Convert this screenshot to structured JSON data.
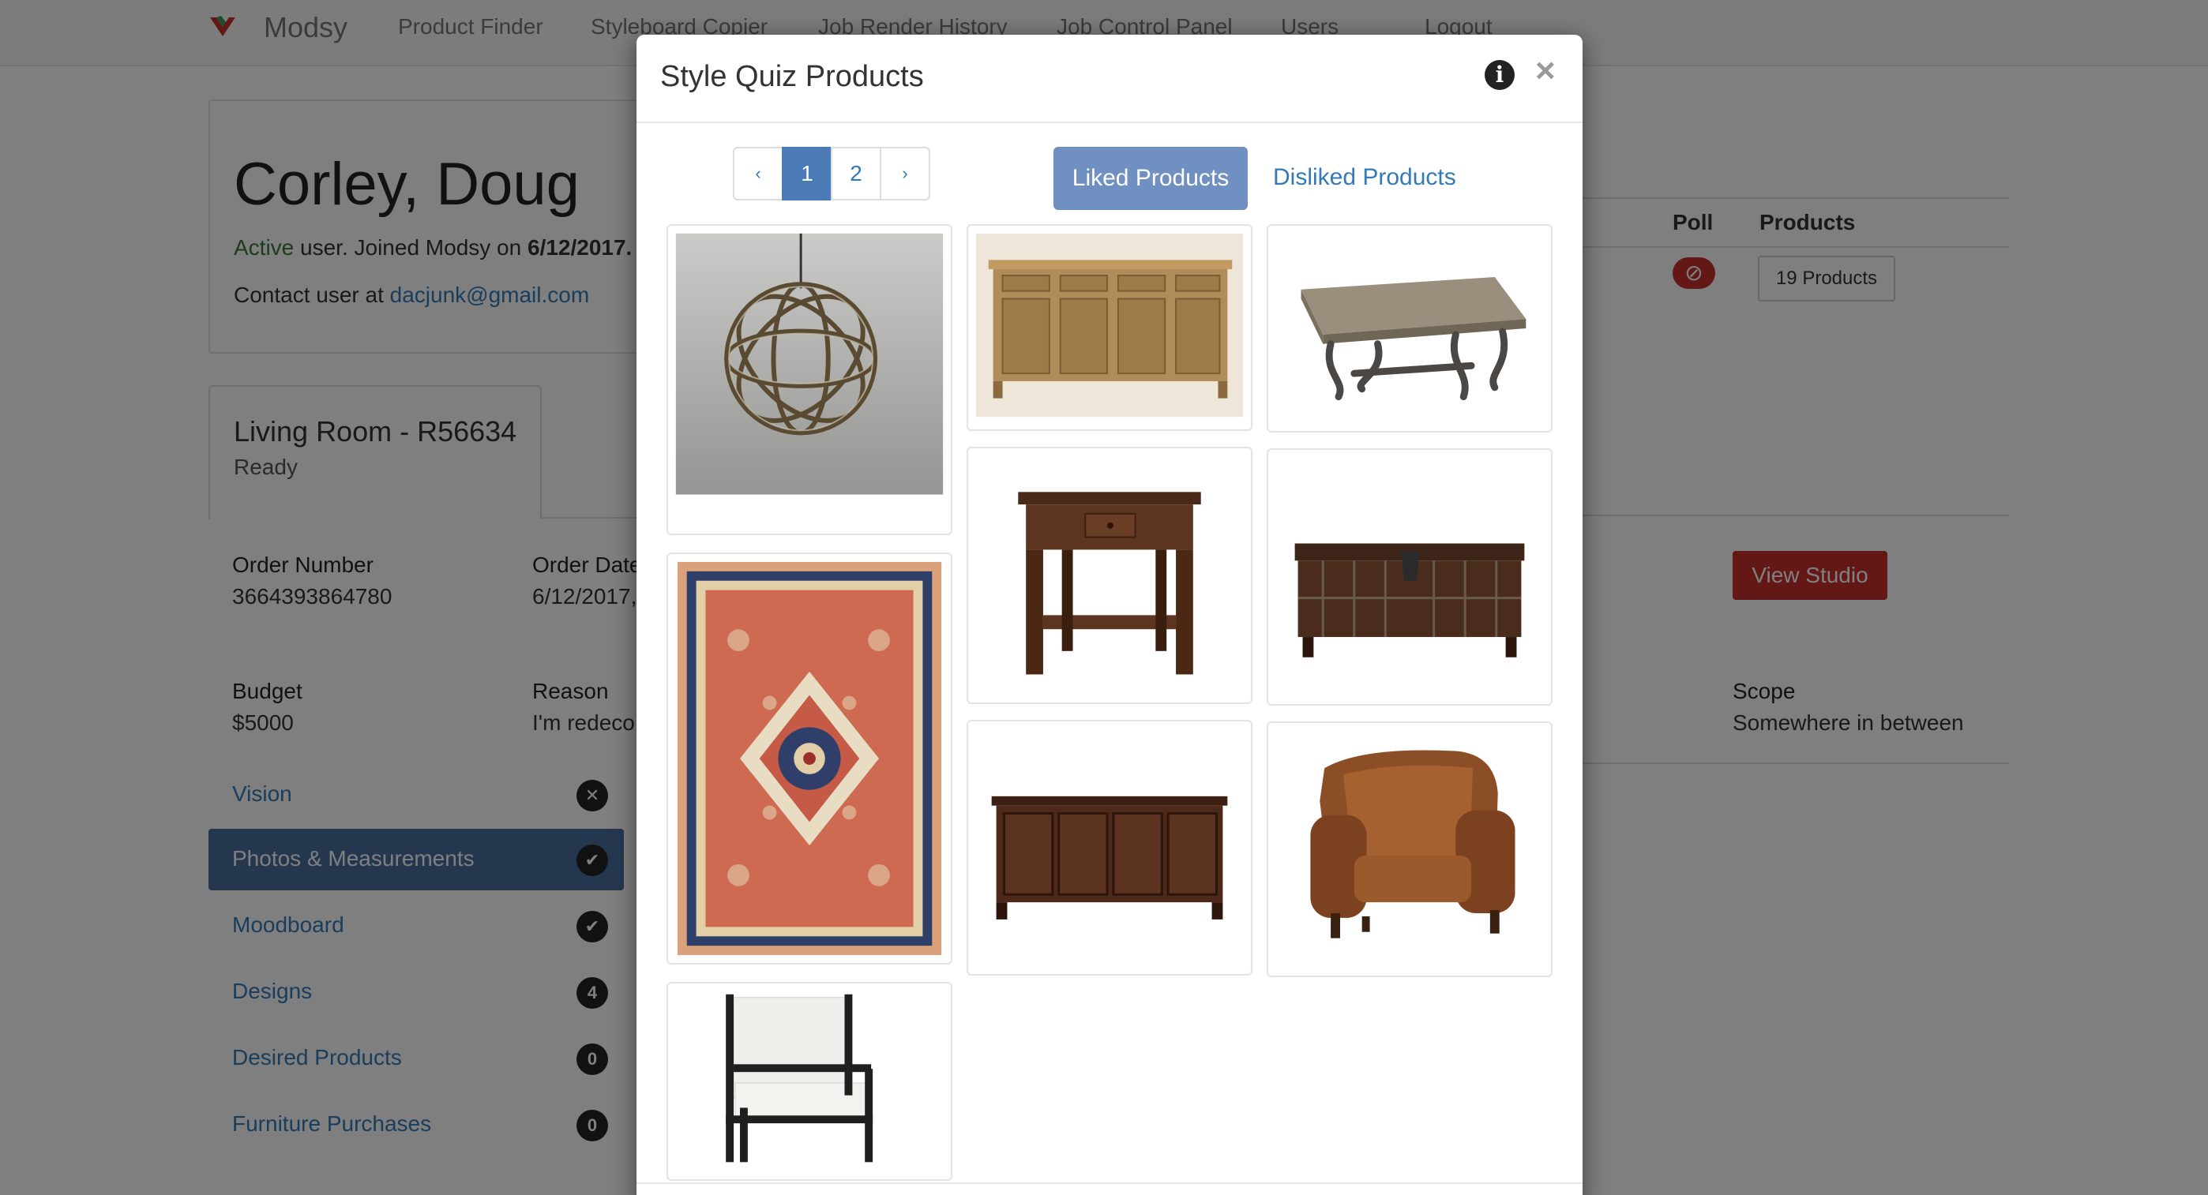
{
  "nav": {
    "brand": "Modsy",
    "items": [
      "Product Finder",
      "Styleboard Copier",
      "Job Render History",
      "Job Control Panel",
      "Users",
      "Logout"
    ]
  },
  "user": {
    "name": "Corley, Doug",
    "status_word": "Active",
    "status_rest": " user. Joined Modsy on ",
    "joined": "6/12/2017.",
    "contact_prefix": "Contact user at ",
    "email": "dacjunk@gmail.com"
  },
  "room": {
    "title": "Living Room - R56634",
    "status": "Ready"
  },
  "order": {
    "number_label": "Order Number",
    "number": "3664393864780",
    "date_label": "Order Date",
    "date": "6/12/2017,",
    "budget_label": "Budget",
    "budget": "$5000",
    "reason_label": "Reason",
    "reason": "I'm redeco",
    "scope_label": "Scope",
    "scope": "Somewhere in between"
  },
  "sidebar": {
    "items": [
      {
        "label": "Vision",
        "badge": "✕"
      },
      {
        "label": "Photos & Measurements",
        "badge": "✔"
      },
      {
        "label": "Moodboard",
        "badge": "✔"
      },
      {
        "label": "Designs",
        "badge": "4"
      },
      {
        "label": "Desired Products",
        "badge": "0"
      },
      {
        "label": "Furniture Purchases",
        "badge": "0"
      }
    ]
  },
  "table": {
    "poll_header": "Poll",
    "products_header": "Products",
    "poll_icon": "⊘",
    "products_button": "19 Products"
  },
  "view_studio": "View Studio",
  "modal": {
    "title": "Style Quiz Products",
    "info_icon": "i",
    "close_icon": "×",
    "pager": {
      "prev": "‹",
      "pages": [
        "1",
        "2"
      ],
      "current": "1",
      "next": "›"
    },
    "tab_liked": "Liked Products",
    "tab_disliked": "Disliked Products",
    "products": [
      {
        "name": "orb-chandelier-image"
      },
      {
        "name": "persian-rug-image"
      },
      {
        "name": "spindle-armchair-image"
      },
      {
        "name": "wood-sideboard-image"
      },
      {
        "name": "end-table-image"
      },
      {
        "name": "media-console-image"
      },
      {
        "name": "scroll-coffee-table-image"
      },
      {
        "name": "storage-trunk-image"
      },
      {
        "name": "leather-armchair-image"
      }
    ]
  },
  "colors": {
    "accent": "#337ab7",
    "active_nav": "#4a6e9f",
    "liked_tab": "#6f90c0",
    "danger": "#c9302c",
    "success": "#3c763d"
  }
}
